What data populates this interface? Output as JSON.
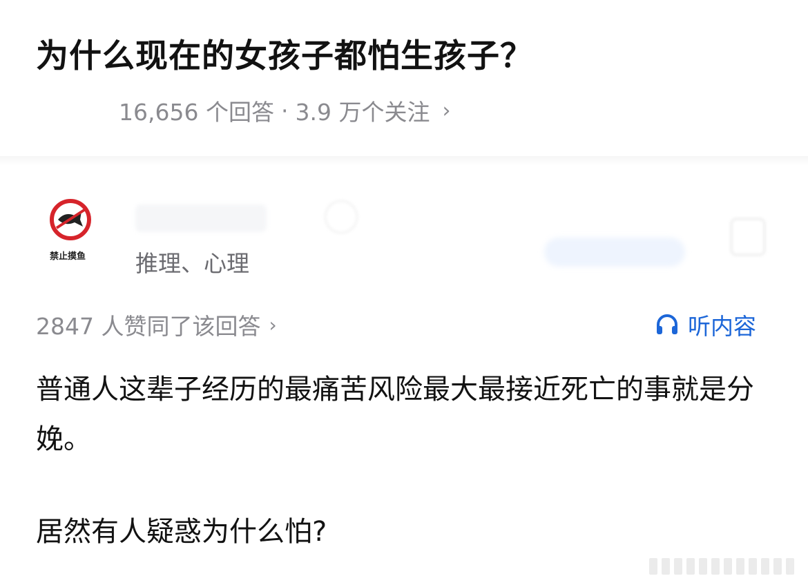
{
  "question": {
    "title": "为什么现在的女孩子都怕生孩子？",
    "answers_count": "16,656 个回答",
    "separator": "·",
    "followers": "3.9 万个关注",
    "chevron": "›"
  },
  "author": {
    "avatar_caption": "禁止摸鱼",
    "tags": "推理、心理"
  },
  "answer": {
    "upvote_text": "2847 人赞同了该回答",
    "chevron": "›",
    "listen_label": "听内容",
    "paragraphs": [
      "普通人这辈子经历的最痛苦风险最大最接近死亡的事就是分娩。",
      "居然有人疑惑为什么怕?"
    ]
  },
  "colors": {
    "accent_blue": "#1c66d8",
    "avatar_red": "#d6242b",
    "meta_gray": "#8a8a8f"
  }
}
